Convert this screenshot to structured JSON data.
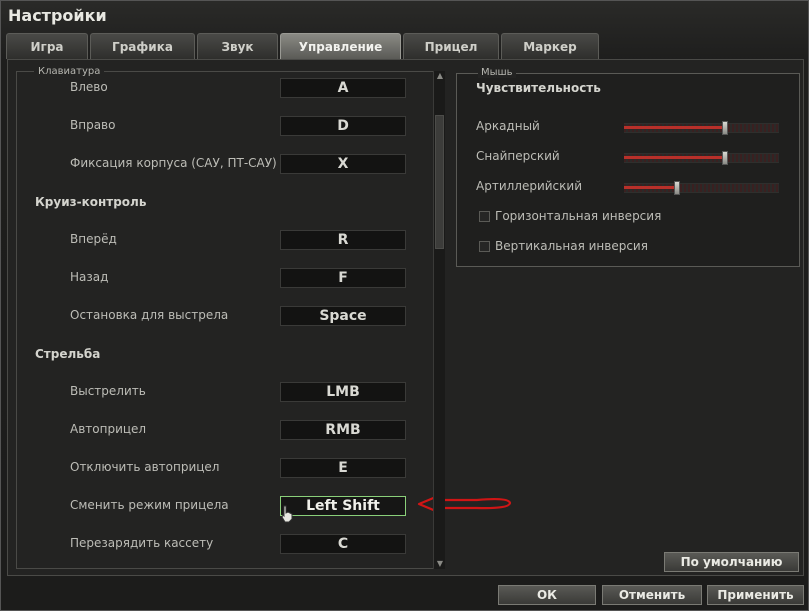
{
  "window": {
    "title": "Настройки"
  },
  "tabs": [
    {
      "label": "Игра"
    },
    {
      "label": "Графика"
    },
    {
      "label": "Звук"
    },
    {
      "label": "Управление"
    },
    {
      "label": "Прицел"
    },
    {
      "label": "Маркер"
    }
  ],
  "keyboard": {
    "legend": "Клавиатура",
    "rows": [
      {
        "label": "Влево",
        "key": "A"
      },
      {
        "label": "Вправо",
        "key": "D"
      },
      {
        "label": "Фиксация корпуса (САУ, ПТ-САУ)",
        "key": "X"
      },
      {
        "section": "Круиз-контроль"
      },
      {
        "label": "Вперёд",
        "key": "R"
      },
      {
        "label": "Назад",
        "key": "F"
      },
      {
        "label": "Остановка для выстрела",
        "key": "Space"
      },
      {
        "section": "Стрельба"
      },
      {
        "label": "Выстрелить",
        "key": "LMB"
      },
      {
        "label": "Автоприцел",
        "key": "RMB"
      },
      {
        "label": "Отключить автоприцел",
        "key": "E"
      },
      {
        "label": "Сменить режим прицела",
        "key": "Left Shift",
        "active": true
      },
      {
        "label": "Перезарядить кассету",
        "key": "C"
      }
    ]
  },
  "mouse": {
    "legend": "Мышь",
    "sensitivity_label": "Чувствительность",
    "sliders": [
      {
        "label": "Аркадный",
        "value": 0.65
      },
      {
        "label": "Снайперский",
        "value": 0.65
      },
      {
        "label": "Артиллерийский",
        "value": 0.34
      }
    ],
    "checkboxes": [
      {
        "label": "Горизонтальная инверсия",
        "checked": false
      },
      {
        "label": "Вертикальная инверсия",
        "checked": false
      }
    ]
  },
  "buttons": {
    "defaults": "По умолчанию",
    "ok": "ОК",
    "cancel": "Отменить",
    "apply": "Применить"
  },
  "colors": {
    "annotation_arrow": "#d01515",
    "active_key_border": "#8ad07a",
    "slider_fill": "#b8302a"
  }
}
